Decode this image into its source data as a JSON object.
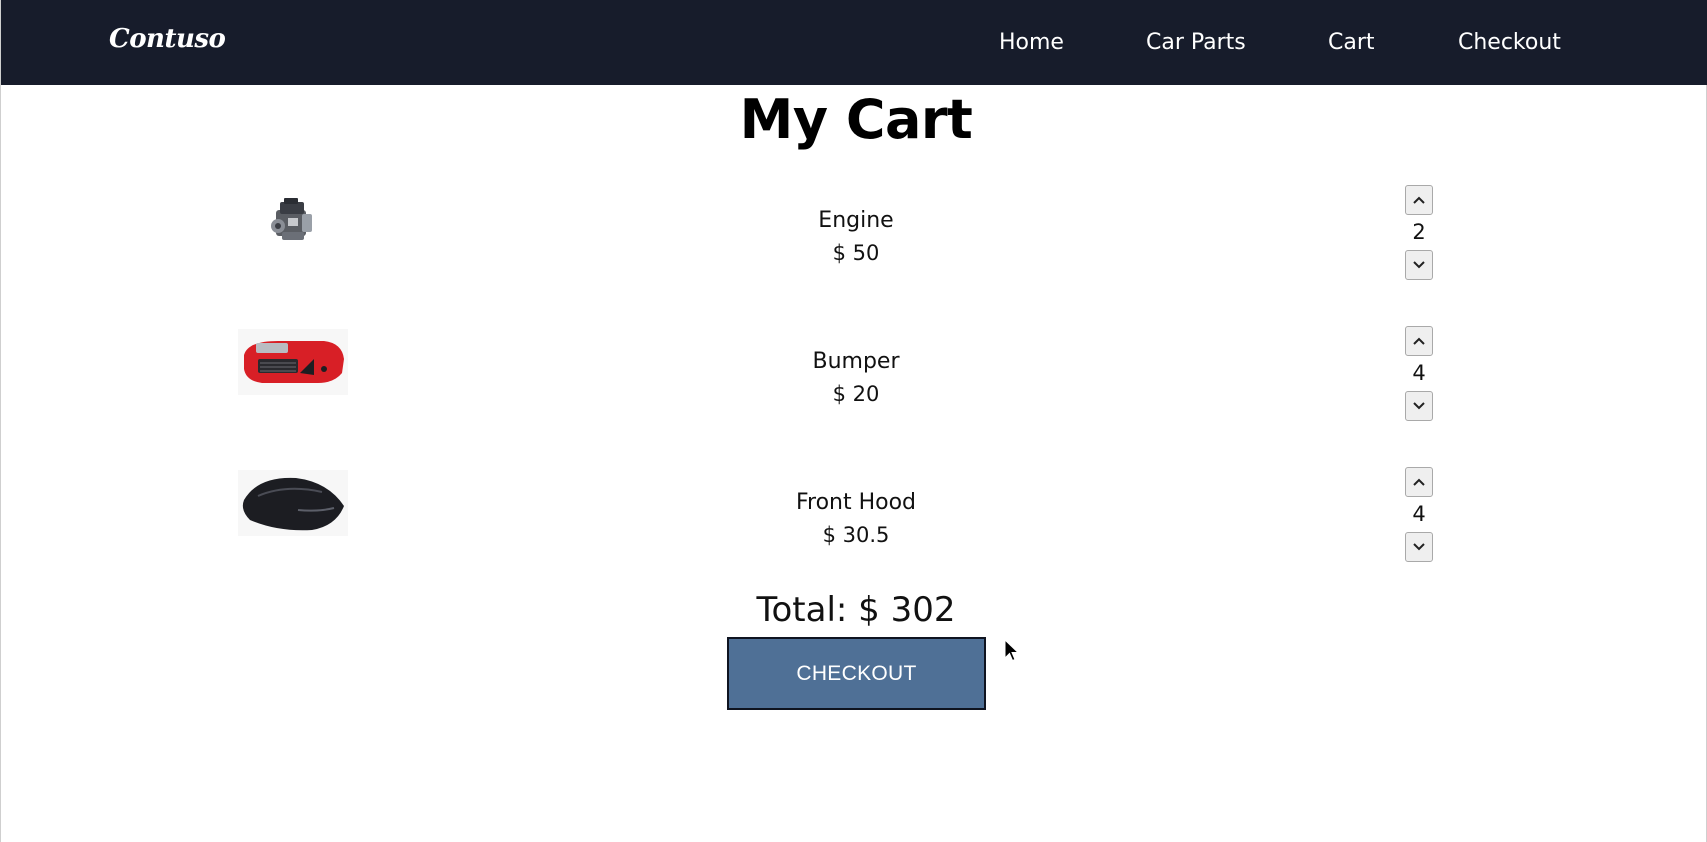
{
  "brand": {
    "name": "Contuso"
  },
  "nav": {
    "home": "Home",
    "car_parts": "Car Parts",
    "cart": "Cart",
    "checkout": "Checkout"
  },
  "page": {
    "title": "My Cart"
  },
  "cart": {
    "items": [
      {
        "name": "Engine",
        "price": "$ 50",
        "quantity": "2",
        "image_icon": "engine-image"
      },
      {
        "name": "Bumper",
        "price": "$ 20",
        "quantity": "4",
        "image_icon": "bumper-image"
      },
      {
        "name": "Front Hood",
        "price": "$ 30.5",
        "quantity": "4",
        "image_icon": "hood-image"
      }
    ],
    "total": "Total: $ 302",
    "checkout_label": "CHECKOUT"
  },
  "colors": {
    "navbar_bg": "#171c2b",
    "checkout_bg": "#4f7096",
    "nav_text": "#ffffff"
  }
}
